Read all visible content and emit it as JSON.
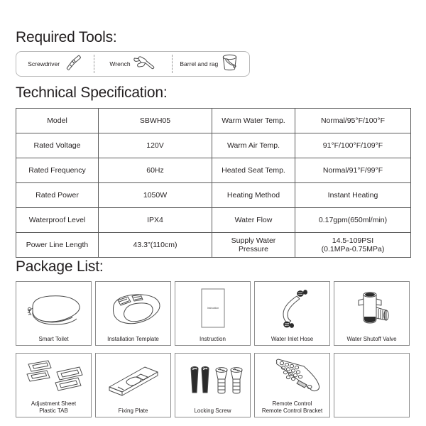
{
  "required_tools": {
    "heading": "Required Tools:",
    "items": [
      {
        "label": "Screwdriver",
        "icon": "screwdriver-icon"
      },
      {
        "label": "Wrench",
        "icon": "wrench-icon"
      },
      {
        "label": "Barrel and rag",
        "icon": "barrel-and-rag-icon"
      }
    ]
  },
  "technical_specification": {
    "heading": "Technical Specification:",
    "rows": [
      {
        "label_left": "Model",
        "value_left": "SBWH05",
        "label_right": "Warm Water Temp.",
        "value_right": "Normal/95°F/100°F"
      },
      {
        "label_left": "Rated Voltage",
        "value_left": "120V",
        "label_right": "Warm Air Temp.",
        "value_right": "91°F/100°F/109°F"
      },
      {
        "label_left": "Rated Frequency",
        "value_left": "60Hz",
        "label_right": "Heated Seat Temp.",
        "value_right": "Normal/91°F/99°F"
      },
      {
        "label_left": "Rated Power",
        "value_left": "1050W",
        "label_right": "Heating Method",
        "value_right": "Instant Heating"
      },
      {
        "label_left": "Waterproof Level",
        "value_left": "IPX4",
        "label_right": "Water Flow",
        "value_right": "0.17gpm(650ml/min)"
      },
      {
        "label_left": "Power Line Length",
        "value_left": "43.3\"(110cm)",
        "label_right": "Supply Water\nPressure",
        "value_right": "14.5-109PSI\n(0.1MPa-0.75MPa)"
      }
    ]
  },
  "package_list": {
    "heading": "Package List:",
    "items": [
      {
        "label": "Smart Toilet",
        "icon": "smart-toilet-icon"
      },
      {
        "label": "Installation Template",
        "icon": "installation-template-icon"
      },
      {
        "label": "Instruction",
        "icon": "instruction-booklet-icon",
        "inner_text": "Instruction"
      },
      {
        "label": "Water Inlet Hose",
        "icon": "water-inlet-hose-icon"
      },
      {
        "label": "Water Shutoff Valve",
        "icon": "water-shutoff-valve-icon"
      },
      {
        "label": "Adjustment Sheet\nPlastic TAB",
        "icon": "adjustment-sheet-plastic-tab-icon"
      },
      {
        "label": "Fixing Plate",
        "icon": "fixing-plate-icon"
      },
      {
        "label": "Locking Screw",
        "icon": "locking-screw-icon"
      },
      {
        "label": "Remote Control\nRemote Control Bracket",
        "icon": "remote-control-icon"
      },
      {
        "label": "",
        "icon": "empty-cell"
      }
    ]
  },
  "colors": {
    "text": "#231f20",
    "table_border": "#5b5b5b",
    "cell_border": "#8d8d8d",
    "tools_border": "#b9b9b9",
    "divider_dashed": "#9a9a9a"
  }
}
